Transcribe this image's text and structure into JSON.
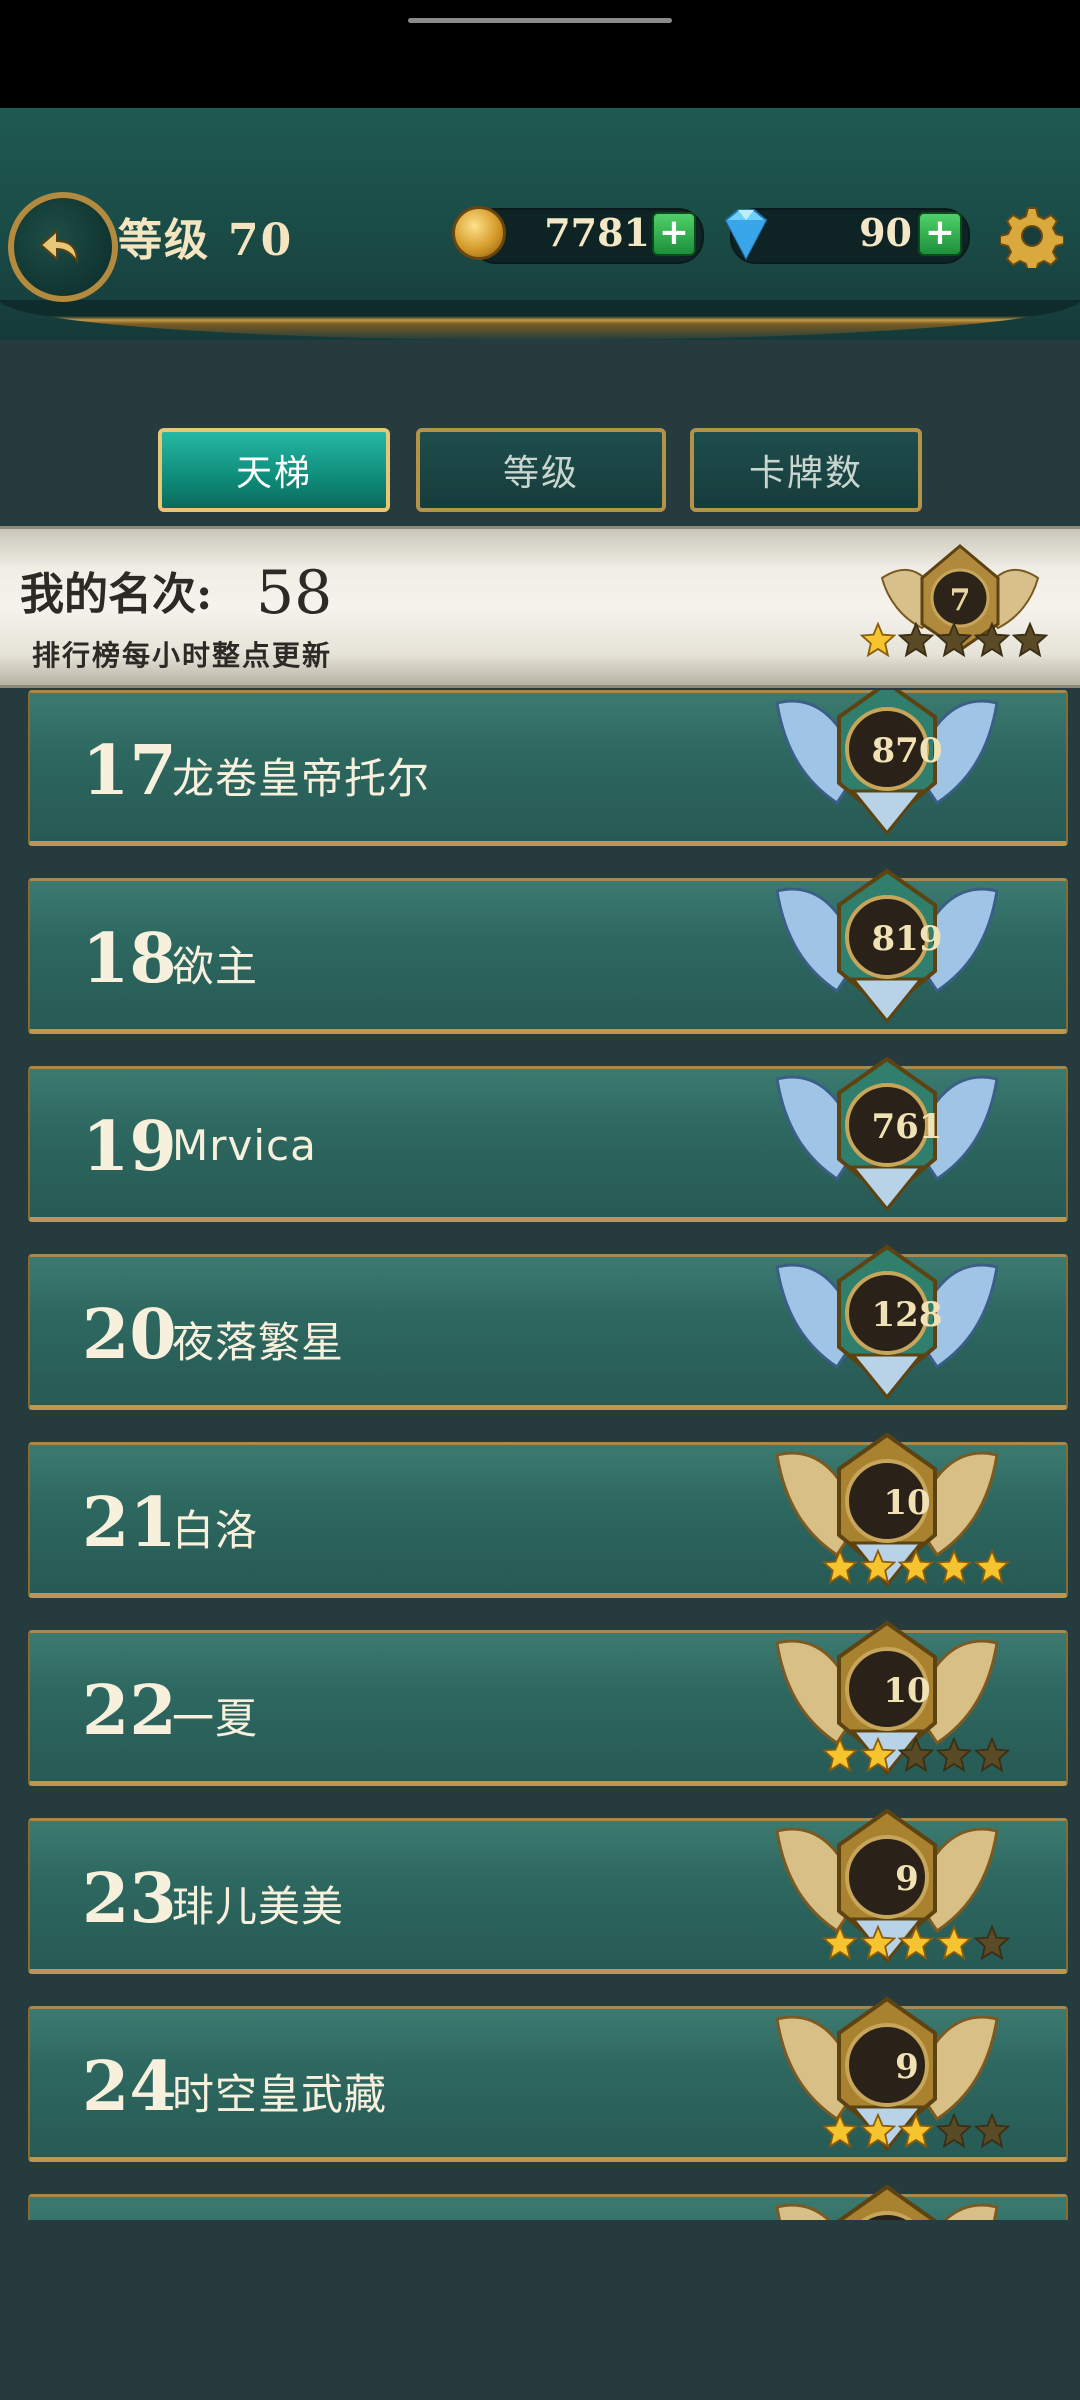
{
  "header": {
    "level_label": "等级",
    "level_value": "70",
    "gold": "7781",
    "gems": "90"
  },
  "tabs": [
    {
      "label": "天梯",
      "active": true
    },
    {
      "label": "等级",
      "active": false
    },
    {
      "label": "卡牌数",
      "active": false
    }
  ],
  "my_rank": {
    "label": "我的名次:",
    "value": "58",
    "note": "排行榜每小时整点更新",
    "badge_value": "7",
    "stars_filled": 1,
    "stars_total": 5
  },
  "rows": [
    {
      "rank": "17",
      "name": "龙卷皇帝托尔",
      "score": "870",
      "emblem": "silver-wing"
    },
    {
      "rank": "18",
      "name": "欲主",
      "score": "819",
      "emblem": "silver-wing"
    },
    {
      "rank": "19",
      "name": "Mrvica",
      "score": "761",
      "emblem": "silver-wing"
    },
    {
      "rank": "20",
      "name": "夜落繁星",
      "score": "128",
      "emblem": "silver-wing"
    },
    {
      "rank": "21",
      "name": "白洛",
      "score": "10",
      "emblem": "gold-wing",
      "stars_filled": 5
    },
    {
      "rank": "22",
      "name": "一夏",
      "score": "10",
      "emblem": "gold-wing",
      "stars_filled": 2
    },
    {
      "rank": "23",
      "name": "琲儿美美",
      "score": "9",
      "emblem": "gold-wing",
      "stars_filled": 4
    },
    {
      "rank": "24",
      "name": "时空皇武藏",
      "score": "9",
      "emblem": "gold-wing",
      "stars_filled": 3
    }
  ],
  "colors": {
    "accent": "#0f8c7a",
    "gold": "#c39a47",
    "row_bg": "#2d6860"
  },
  "icons": [
    "back-arrow-icon",
    "coin-icon",
    "diamond-icon",
    "plus-icon",
    "gear-icon",
    "star-icon",
    "rank-emblem-icon"
  ]
}
